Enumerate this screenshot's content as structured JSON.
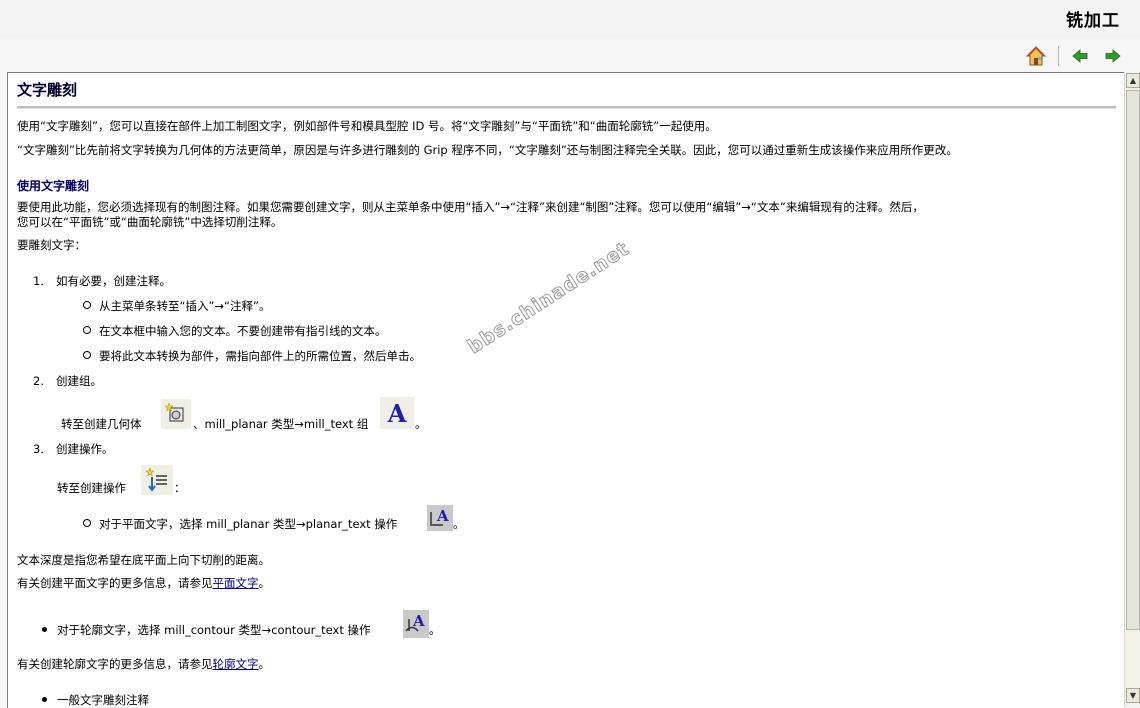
{
  "header": {
    "title": "铣加工"
  },
  "page": {
    "title": "文字雕刻",
    "intro1": "使用“文字雕刻”，您可以直接在部件上加工制图文字，例如部件号和模具型腔 ID 号。将“文字雕刻”与“平面铣”和“曲面轮廓铣”一起使用。",
    "intro2": "“文字雕刻”比先前将文字转换为几何体的方法更简单，原因是与许多进行雕刻的 Grip 程序不同，“文字雕刻”还与制图注释完全关联。因此，您可以通过重新生成该操作来应用所作更改。",
    "section_heading": "使用文字雕刻",
    "para1_line1": "要使用此功能，您必须选择现有的制图注释。如果您需要创建文字，则从主菜单条中使用“插入”→“注释”来创建“制图”注释。您可以使用“编辑”→“文本”来编辑现有的注释。然后，",
    "para1_line2": "您可以在“平面铣”或“曲面轮廓铣”中选择切削注释。",
    "steps_intro": "要雕刻文字：",
    "steps": [
      {
        "num": "1.",
        "label": "如有必要，创建注释。"
      },
      {
        "num": "2.",
        "label": "创建组。"
      },
      {
        "num": "3.",
        "label": "创建操作。"
      }
    ],
    "step1_bullets": [
      "从主菜单条转至“插入”→“注释”。",
      "在文本框中输入您的文本。不要创建带有指引线的文本。",
      "要将此文本转换为部件，需指向部件上的所需位置，然后单击。"
    ],
    "step2_text_a": "转至创建几何体",
    "step2_text_b": "、mill_planar 类型→mill_text 组",
    "step2_text_c": "。",
    "step3_text_a": "转至创建操作",
    "step3_text_b": "：",
    "step3_bullet_a": "对于平面文字，选择  mill_planar 类型→planar_text 操作",
    "step3_bullet_b": "。",
    "depth_note": "文本深度是指您希望在底平面上向下切削的距离。",
    "planar_more_a": "有关创建平面文字的更多信息，请参见",
    "planar_more_link": "平面文字",
    "planar_more_b": "。",
    "contour_bullet_a": "对于轮廓文字，选择  mill_contour 类型→contour_text 操作",
    "contour_bullet_b": "。",
    "contour_more_a": "有关创建轮廓文字的更多信息，请参见",
    "contour_more_link": "轮廓文字",
    "contour_more_b": "。",
    "last_bullet": "一般文字雕刻注释"
  },
  "watermark": "bbs.chinade.net",
  "icons": {
    "home": "home-icon",
    "back": "back-arrow-icon",
    "forward": "forward-arrow-icon",
    "create_geometry": "create-geometry-icon",
    "mill_text_group": "mill-text-group-icon",
    "create_operation": "create-operation-icon",
    "planar_text": "planar-text-icon",
    "contour_text": "contour-text-icon"
  },
  "colors": {
    "heading": "#000033",
    "link": "#000080",
    "arrows": "#2e9a2e"
  }
}
